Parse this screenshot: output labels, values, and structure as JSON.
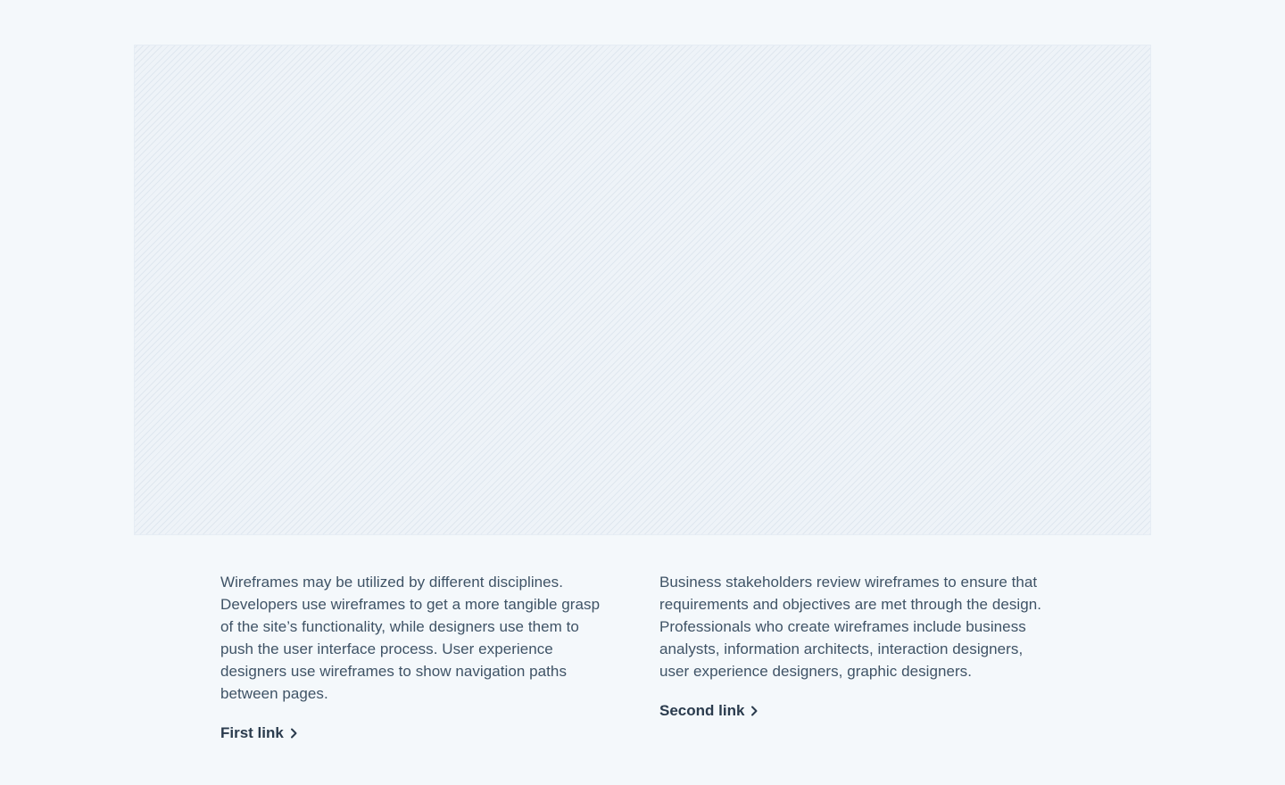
{
  "hero": {
    "placeholder_pattern": "diagonal-hatch",
    "background_color": "#eef3f8",
    "hatch_color": "#dfe7ef"
  },
  "columns": [
    {
      "text": "Wireframes may be utilized by different disciplines. Developers use wireframes to get a more tangible grasp of the site’s functionality, while designers use them to push the user interface process. User experience designers use wireframes to show navigation paths between pages.",
      "link_label": "First link",
      "link_icon": "chevron-right-icon"
    },
    {
      "text": "Business stakeholders review wireframes to ensure that requirements and objectives are met through the design. Professionals who create wireframes include business analysts, information architects, interaction designers, user experience designers, graphic designers.",
      "link_label": "Second link",
      "link_icon": "chevron-right-icon"
    }
  ],
  "colors": {
    "page_background": "#f4f8fb",
    "body_text": "#3f5366",
    "link_text": "#2a3b4d"
  }
}
